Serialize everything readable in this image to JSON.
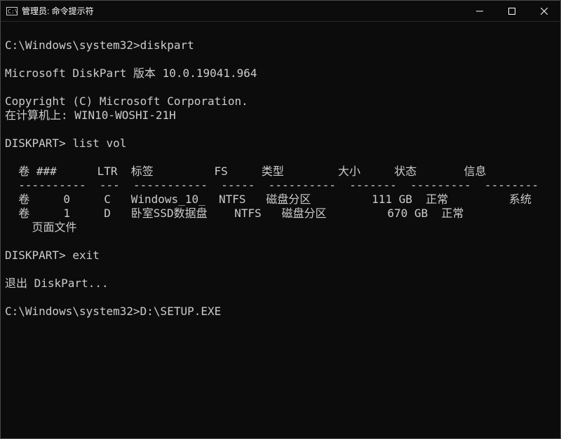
{
  "titlebar": {
    "title": "管理员: 命令提示符"
  },
  "terminal": {
    "lines": [
      "",
      "C:\\Windows\\system32>diskpart",
      "",
      "Microsoft DiskPart 版本 10.0.19041.964",
      "",
      "Copyright (C) Microsoft Corporation.",
      "在计算机上: WIN10-WOSHI-21H",
      "",
      "DISKPART> list vol",
      "",
      "  卷 ###      LTR  标签         FS     类型        大小     状态       信息",
      "  ----------  ---  -----------  -----  ----------  -------  ---------  --------",
      "  卷     0     C   Windows_10_  NTFS   磁盘分区         111 GB  正常         系统",
      "  卷     1     D   卧室SSD数据盘    NTFS   磁盘分区         670 GB  正常",
      "    页面文件",
      "",
      "DISKPART> exit",
      "",
      "退出 DiskPart...",
      "",
      "C:\\Windows\\system32>D:\\SETUP.EXE"
    ]
  },
  "diskpart": {
    "version": "10.0.19041.964",
    "computer": "WIN10-WOSHI-21H",
    "command_listvol": "list vol",
    "command_exit": "exit",
    "columns": [
      "卷 ###",
      "LTR",
      "标签",
      "FS",
      "类型",
      "大小",
      "状态",
      "信息"
    ],
    "volumes": [
      {
        "index": 0,
        "ltr": "C",
        "label": "Windows_10_",
        "fs": "NTFS",
        "type": "磁盘分区",
        "size": "111 GB",
        "status": "正常",
        "info": "系统"
      },
      {
        "index": 1,
        "ltr": "D",
        "label": "卧室SSD数据盘",
        "fs": "NTFS",
        "type": "磁盘分区",
        "size": "670 GB",
        "status": "正常",
        "info": "页面文件"
      }
    ],
    "exit_message": "退出 DiskPart..."
  },
  "prompt": {
    "cwd": "C:\\Windows\\system32",
    "last_command": "D:\\SETUP.EXE"
  }
}
